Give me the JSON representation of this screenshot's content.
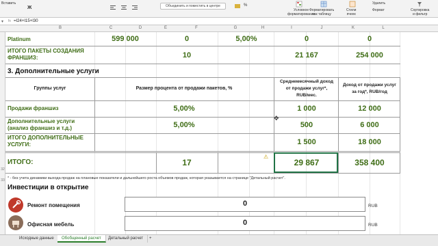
{
  "ribbon": {
    "paste_label": "Вставить",
    "merge_label": "Объединить и поместить в центре",
    "number_format_label": "%",
    "conditional_label_1": "Условное",
    "conditional_label_2": "форматирование",
    "format_table_label_1": "Форматировать",
    "format_table_label_2": "как таблицу",
    "styles_label_1": "Стили",
    "styles_label_2": "ячеек",
    "delete_label": "Удалить",
    "format_label": "Формат",
    "sort_label_1": "Сортировка",
    "sort_label_2": "и фильтр"
  },
  "formula_bar": {
    "fx": "fx",
    "formula": "=I24+I15+I30"
  },
  "columns": [
    "B",
    "C",
    "D",
    "E",
    "F",
    "G",
    "H",
    "I",
    "J",
    "K",
    "L"
  ],
  "rows": {
    "r1": "",
    "r2": "",
    "r3": "",
    "r4": "",
    "r5": "",
    "r6": "",
    "r7": "",
    "r8": "",
    "r9": "",
    "r10": "",
    "r11": "",
    "r12": "",
    "r13": "",
    "r14": "",
    "r15": "",
    "r16": "",
    "r17": "",
    "r18": "",
    "r19": "",
    "r20": "",
    "r21": "",
    "r22": "",
    "r23": "",
    "r24": "",
    "r25": "",
    "r26": "",
    "r27": "",
    "r28": "",
    "r29": "",
    "r30": "",
    "r31": "",
    "r32": "32",
    "r33": "33",
    "r34": "",
    "r35": "",
    "r36": "",
    "r37": "",
    "r38": "",
    "r39": "",
    "r40": ""
  },
  "platinum": {
    "label": "Platinum",
    "price": "599 000",
    "count": "0",
    "percent": "5,00%",
    "monthly": "0",
    "yearly": "0"
  },
  "franchise_total": {
    "label_1": "ИТОГО ПАКЕТЫ СОЗДАНИЯ",
    "label_2": "ФРАНШИЗ:",
    "count": "10",
    "monthly": "21 167",
    "yearly": "254 000"
  },
  "section3": {
    "title": "3. Дополнительные услуги",
    "col_group": "Группы услуг",
    "col_percent": "Размер процента от продажи пакетов, %",
    "col_monthly_1": "Среднемесячный доход",
    "col_monthly_2": "от продажи услуг*,",
    "col_monthly_3": "RUB/мес.",
    "col_yearly_1": "Доход от продажи услуг",
    "col_yearly_2": "за год*, RUB/год",
    "rows": [
      {
        "label_1": "Продажи франшиз",
        "label_2": "",
        "percent": "5,00%",
        "monthly": "1 000",
        "yearly": "12 000"
      },
      {
        "label_1": "Дополнительные услуги",
        "label_2": "(анализ франшиз и т.д.)",
        "percent": "5,00%",
        "monthly": "500",
        "yearly": "6 000"
      }
    ],
    "total_label_1": "ИТОГО ДОПОЛНИТЕЛЬНЫЕ",
    "total_label_2": "УСЛУГИ:",
    "total_monthly": "1 500",
    "total_yearly": "18 000"
  },
  "grand_total": {
    "label": "ИТОГО:",
    "count": "17",
    "monthly": "29 867",
    "yearly": "358 400"
  },
  "footnote": "* - без учета динамики выхода продаж на плановые показатели и дальнейшего роста объемов продаж, которая указывается на странице \"Детальный расчет\".",
  "investments": {
    "title": "Инвестиции в открытие",
    "items": [
      {
        "label": "Ремонт помещения",
        "value": "0",
        "unit": "RUB"
      },
      {
        "label": "Офисная мебель",
        "value": "0",
        "unit": "RUB"
      }
    ]
  },
  "tabs": [
    "Исходные данные",
    "Обобщенный расчет",
    "Детальный расчет"
  ],
  "status": "+"
}
